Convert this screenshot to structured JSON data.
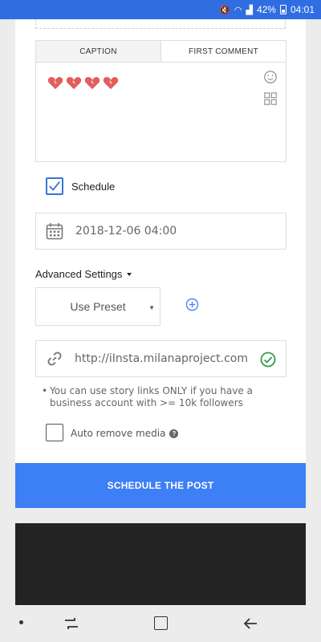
{
  "status_bar": {
    "battery": "42%",
    "time": "04:01"
  },
  "caption_box": {
    "tabs": [
      {
        "label": "CAPTION",
        "active": true
      },
      {
        "label": "FIRST COMMENT",
        "active": false
      }
    ],
    "emoji_icons": [
      "broken-heart-icon",
      "broken-heart-icon",
      "broken-heart-icon",
      "broken-heart-icon"
    ]
  },
  "schedule": {
    "label": "Schedule",
    "checked": true,
    "datetime": "2018-12-06 04:00"
  },
  "advanced_settings": {
    "label": "Advanced Settings",
    "preset_selected": "Use Preset"
  },
  "story_link": {
    "value": "http://iInsta.milanaproject.com",
    "note": "You can use story links ONLY if you have a business account with >= 10k followers"
  },
  "auto_remove": {
    "label": "Auto remove media",
    "checked": false
  },
  "actions": {
    "schedule_button": "SCHEDULE THE POST"
  },
  "colors": {
    "accent": "#3d7ff5",
    "status_bar": "#2f6de1",
    "success": "#2f9e44",
    "heart": "#e25d5d"
  }
}
